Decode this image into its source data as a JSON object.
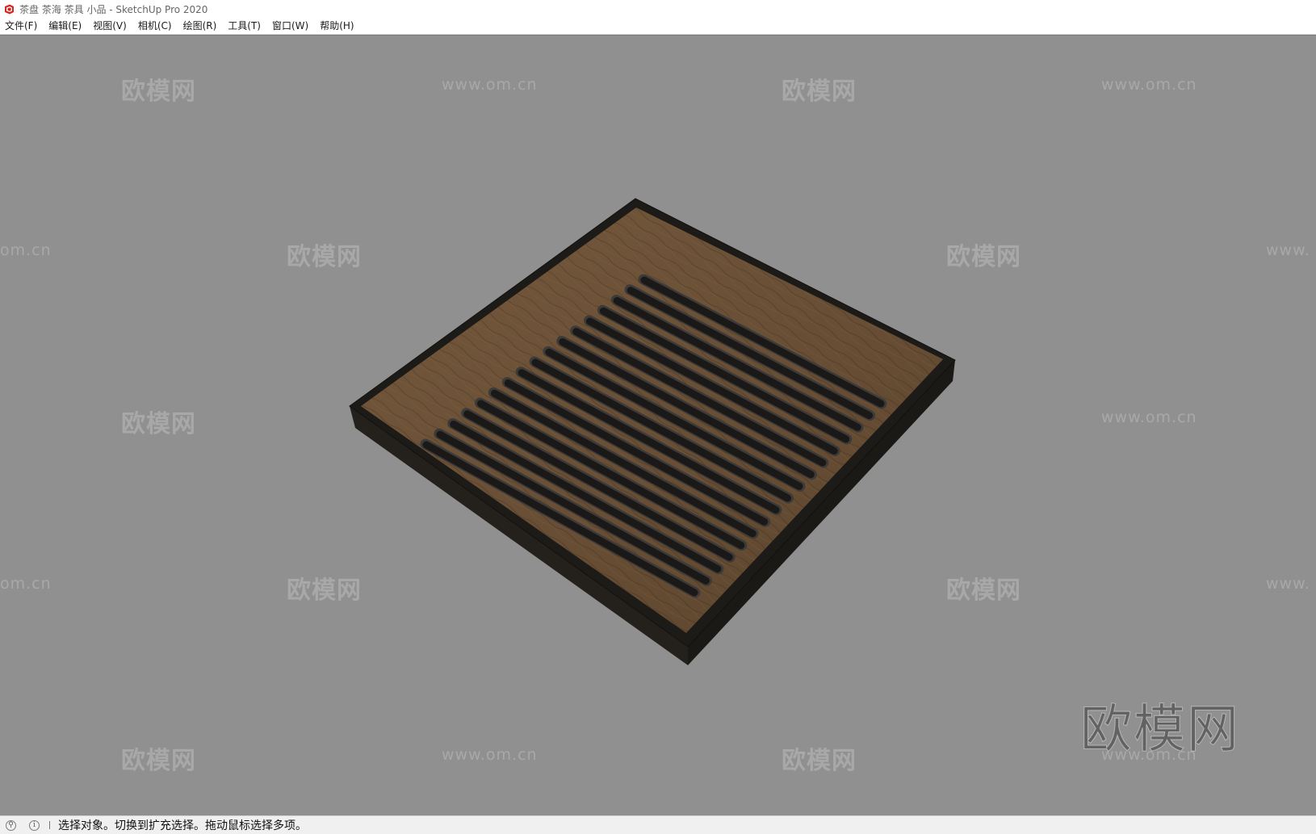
{
  "window": {
    "title": "茶盘 茶海 茶具 小品 - SketchUp Pro 2020",
    "app_icon": "sketchup-logo-icon"
  },
  "menu": {
    "items": [
      "文件(F)",
      "编辑(E)",
      "视图(V)",
      "相机(C)",
      "绘图(R)",
      "工具(T)",
      "窗口(W)",
      "帮助(H)"
    ]
  },
  "viewport": {
    "background": "#909090",
    "model": "wooden tea tray with slatted drain top",
    "wood_color": "#6b5238",
    "frame_color": "#1c1a17",
    "slot_count": 17
  },
  "watermarks": {
    "brand_cn": "欧模网",
    "url": "www.om.cn",
    "url_fragment_left": "om.cn",
    "url_fragment_right": "www.",
    "big_brand": "欧模网"
  },
  "status": {
    "geo_icon": "geo-location-icon",
    "info_icon": "info-icon",
    "text": "选择对象。切换到扩充选择。拖动鼠标选择多项。"
  }
}
